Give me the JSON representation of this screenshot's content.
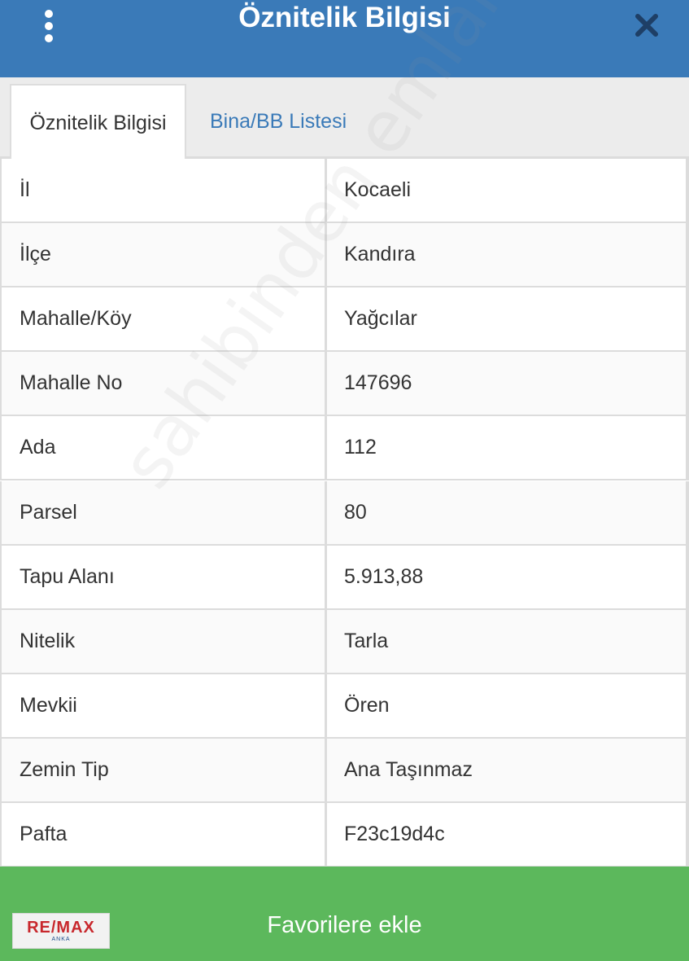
{
  "header": {
    "title": "Öznitelik Bilgisi"
  },
  "tabs": [
    {
      "label": "Öznitelik Bilgisi",
      "active": true
    },
    {
      "label": "Bina/BB Listesi",
      "active": false
    }
  ],
  "rows": [
    {
      "label": "İl",
      "value": "Kocaeli"
    },
    {
      "label": "İlçe",
      "value": "Kandıra"
    },
    {
      "label": "Mahalle/Köy",
      "value": "Yağcılar"
    },
    {
      "label": "Mahalle No",
      "value": "147696"
    },
    {
      "label": "Ada",
      "value": "112"
    },
    {
      "label": "Parsel",
      "value": "80"
    },
    {
      "label": "Tapu Alanı",
      "value": "5.913,88"
    },
    {
      "label": "Nitelik",
      "value": "Tarla"
    },
    {
      "label": "Mevkii",
      "value": "Ören"
    },
    {
      "label": "Zemin Tip",
      "value": "Ana Taşınmaz"
    },
    {
      "label": "Pafta",
      "value": "F23c19d4c"
    }
  ],
  "footer": {
    "button_label": "Favorilere ekle"
  },
  "logo": {
    "main": "RE/MAX",
    "sub": "ANKA"
  },
  "watermark": "sahibinden emlakjet.com",
  "colors": {
    "header": "#3a7ab8",
    "tab_link": "#3a7ab8",
    "footer": "#5cb85c"
  },
  "icons": {
    "menu": "vertical-dots-icon",
    "close": "close-x-icon"
  }
}
